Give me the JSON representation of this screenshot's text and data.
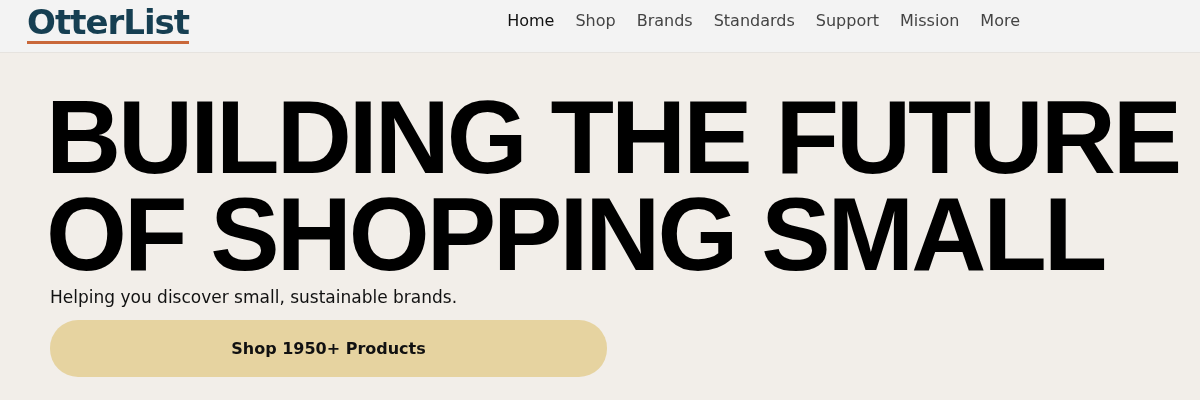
{
  "header": {
    "logo": "OtterList",
    "nav": [
      {
        "label": "Home",
        "selected": true
      },
      {
        "label": "Shop",
        "selected": false
      },
      {
        "label": "Brands",
        "selected": false
      },
      {
        "label": "Standards",
        "selected": false
      },
      {
        "label": "Support",
        "selected": false
      },
      {
        "label": "Mission",
        "selected": false
      },
      {
        "label": "More",
        "selected": false
      }
    ]
  },
  "hero": {
    "headline": [
      "BUILDING THE FUTURE",
      "OF SHOPPING SMALL"
    ],
    "subtitle": "Helping you discover small, sustainable brands.",
    "button": "Shop 1950+ Products"
  }
}
